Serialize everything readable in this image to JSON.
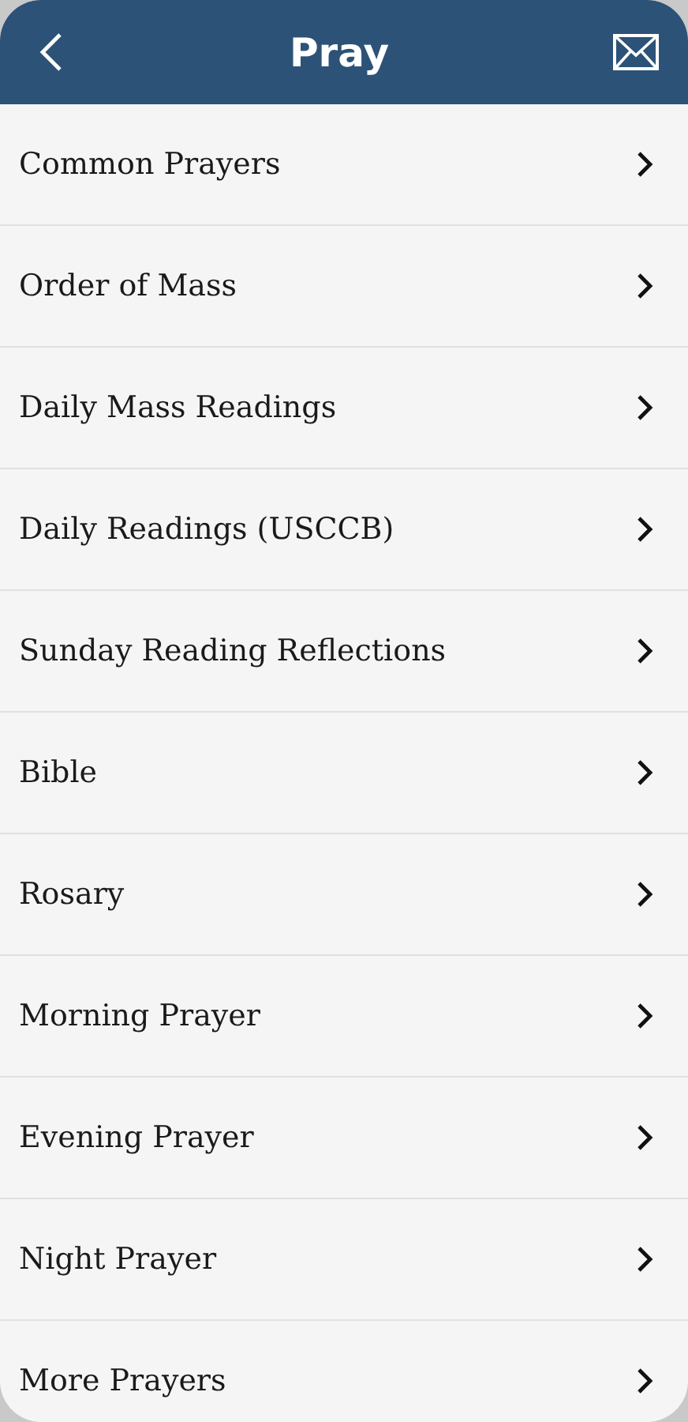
{
  "header": {
    "title": "Pray"
  },
  "items": [
    {
      "label": "Common Prayers"
    },
    {
      "label": "Order of Mass"
    },
    {
      "label": "Daily Mass Readings"
    },
    {
      "label": "Daily Readings (USCCB)"
    },
    {
      "label": "Sunday Reading Reflections"
    },
    {
      "label": "Bible"
    },
    {
      "label": "Rosary"
    },
    {
      "label": "Morning Prayer"
    },
    {
      "label": "Evening Prayer"
    },
    {
      "label": "Night Prayer"
    },
    {
      "label": "More Prayers"
    }
  ]
}
